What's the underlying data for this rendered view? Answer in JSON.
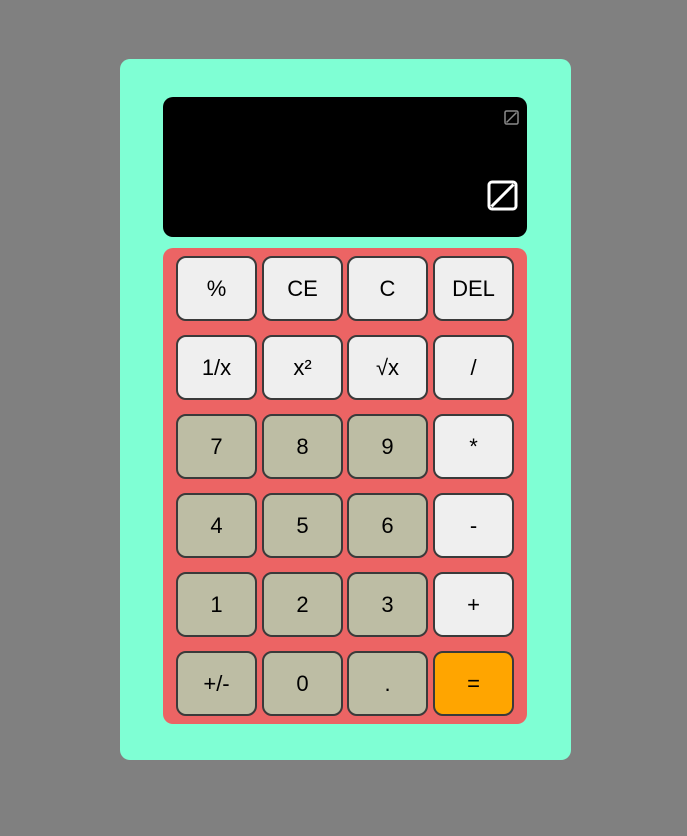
{
  "colors": {
    "page_background": "#808080",
    "calculator_body": "#7fffd4",
    "display_background": "#000000",
    "keypad_background": "#ec6464",
    "function_key": "#efefef",
    "number_key": "#bdbda4",
    "equals_key": "#ffa500"
  },
  "display": {
    "history_icon": "broken-image-icon",
    "result_icon": "broken-image-icon"
  },
  "keypad": {
    "rows": [
      [
        {
          "label": "%",
          "name": "percent-button",
          "kind": "light"
        },
        {
          "label": "CE",
          "name": "clear-entry-button",
          "kind": "light"
        },
        {
          "label": "C",
          "name": "clear-button",
          "kind": "light"
        },
        {
          "label": "DEL",
          "name": "delete-button",
          "kind": "light"
        }
      ],
      [
        {
          "label": "1/x",
          "name": "reciprocal-button",
          "kind": "light"
        },
        {
          "label": "x²",
          "name": "square-button",
          "kind": "light"
        },
        {
          "label": "√x",
          "name": "square-root-button",
          "kind": "light"
        },
        {
          "label": "/",
          "name": "divide-button",
          "kind": "light"
        }
      ],
      [
        {
          "label": "7",
          "name": "digit-7-button",
          "kind": "num"
        },
        {
          "label": "8",
          "name": "digit-8-button",
          "kind": "num"
        },
        {
          "label": "9",
          "name": "digit-9-button",
          "kind": "num"
        },
        {
          "label": "*",
          "name": "multiply-button",
          "kind": "light"
        }
      ],
      [
        {
          "label": "4",
          "name": "digit-4-button",
          "kind": "num"
        },
        {
          "label": "5",
          "name": "digit-5-button",
          "kind": "num"
        },
        {
          "label": "6",
          "name": "digit-6-button",
          "kind": "num"
        },
        {
          "label": "-",
          "name": "subtract-button",
          "kind": "light"
        }
      ],
      [
        {
          "label": "1",
          "name": "digit-1-button",
          "kind": "num"
        },
        {
          "label": "2",
          "name": "digit-2-button",
          "kind": "num"
        },
        {
          "label": "3",
          "name": "digit-3-button",
          "kind": "num"
        },
        {
          "label": "+",
          "name": "add-button",
          "kind": "light"
        }
      ],
      [
        {
          "label": "+/-",
          "name": "negate-button",
          "kind": "num"
        },
        {
          "label": "0",
          "name": "digit-0-button",
          "kind": "num"
        },
        {
          "label": ".",
          "name": "decimal-point-button",
          "kind": "num"
        },
        {
          "label": "=",
          "name": "equals-button",
          "kind": "eq"
        }
      ]
    ]
  }
}
